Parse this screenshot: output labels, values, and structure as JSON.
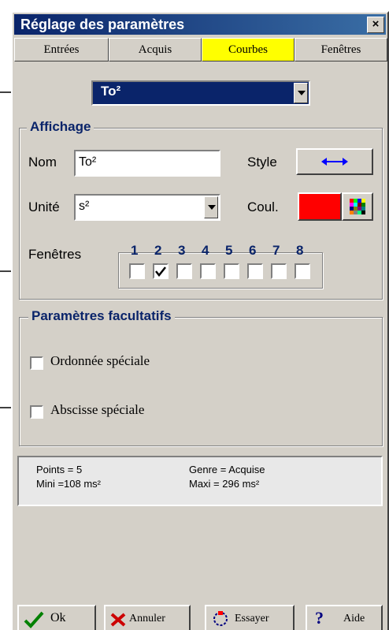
{
  "window": {
    "title": "Réglage des paramètres",
    "close_glyph": "×"
  },
  "tabs": [
    {
      "label": "Entrées",
      "active": false
    },
    {
      "label": "Acquis",
      "active": false
    },
    {
      "label": "Courbes",
      "active": true
    },
    {
      "label": "Fenêtres",
      "active": false
    }
  ],
  "curve_select": {
    "value": "To²"
  },
  "affichage": {
    "legend": "Affichage",
    "nom_label": "Nom",
    "nom_value": "To²",
    "style_label": "Style",
    "unite_label": "Unité",
    "unite_value": "s²",
    "coul_label": "Coul.",
    "color": "#ff0000",
    "fenetres_label": "Fenêtres",
    "window_numbers": [
      "1",
      "2",
      "3",
      "4",
      "5",
      "6",
      "7",
      "8"
    ],
    "window_checked": [
      false,
      true,
      false,
      false,
      false,
      false,
      false,
      false
    ]
  },
  "optional": {
    "legend": "Paramètres facultatifs",
    "ordonnee_label": "Ordonnée spéciale",
    "ordonnee_checked": false,
    "abscisse_label": "Abscisse spéciale",
    "abscisse_checked": false
  },
  "info": {
    "points": "Points = 5",
    "genre": "Genre = Acquise",
    "mini": "Mini =108 ms²",
    "maxi": "Maxi = 296 ms²"
  },
  "buttons": {
    "ok": "Ok",
    "annuler": "Annuler",
    "essayer": "Essayer",
    "aide": "Aide"
  },
  "colors": {
    "title_bar": "#0a246a",
    "active_tab": "#ffff00",
    "selection": "#0a246a",
    "legend_text": "#0a246a",
    "style_arrow": "#0000ff"
  }
}
